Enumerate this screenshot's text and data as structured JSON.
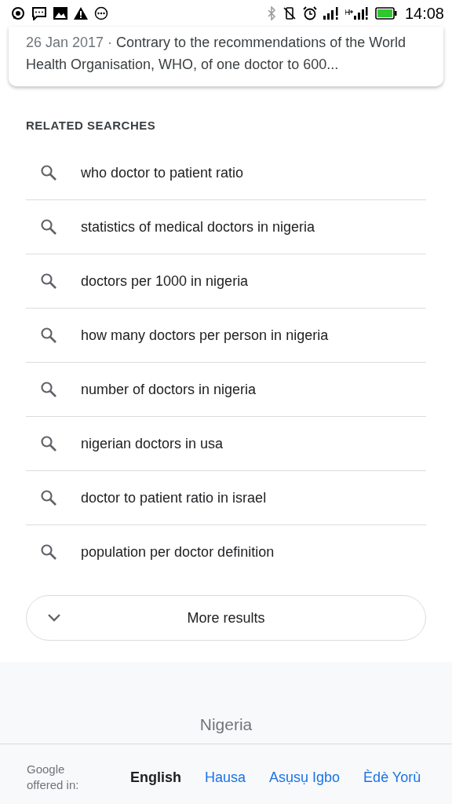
{
  "status_bar": {
    "time": "14:08"
  },
  "result_snippet": {
    "date": "26 Jan 2017 ·",
    "text": "Contrary to the recommendations of the World Health Organisation, WHO, of one doctor to 600..."
  },
  "related_searches": {
    "heading": "RELATED SEARCHES",
    "items": [
      "who doctor to patient ratio",
      "statistics of medical doctors in nigeria",
      "doctors per 1000 in nigeria",
      "how many doctors per person in nigeria",
      "number of doctors in nigeria",
      "nigerian doctors in usa",
      "doctor to patient ratio in israel",
      "population per doctor definition"
    ],
    "more_button": "More results"
  },
  "footer": {
    "location": "Nigeria",
    "offered_in": "Google offered in:",
    "languages": [
      {
        "label": "English",
        "selected": true
      },
      {
        "label": "Hausa",
        "selected": false
      },
      {
        "label": "Asụsụ Igbo",
        "selected": false
      },
      {
        "label": "Èdè Yorù",
        "selected": false
      }
    ]
  }
}
